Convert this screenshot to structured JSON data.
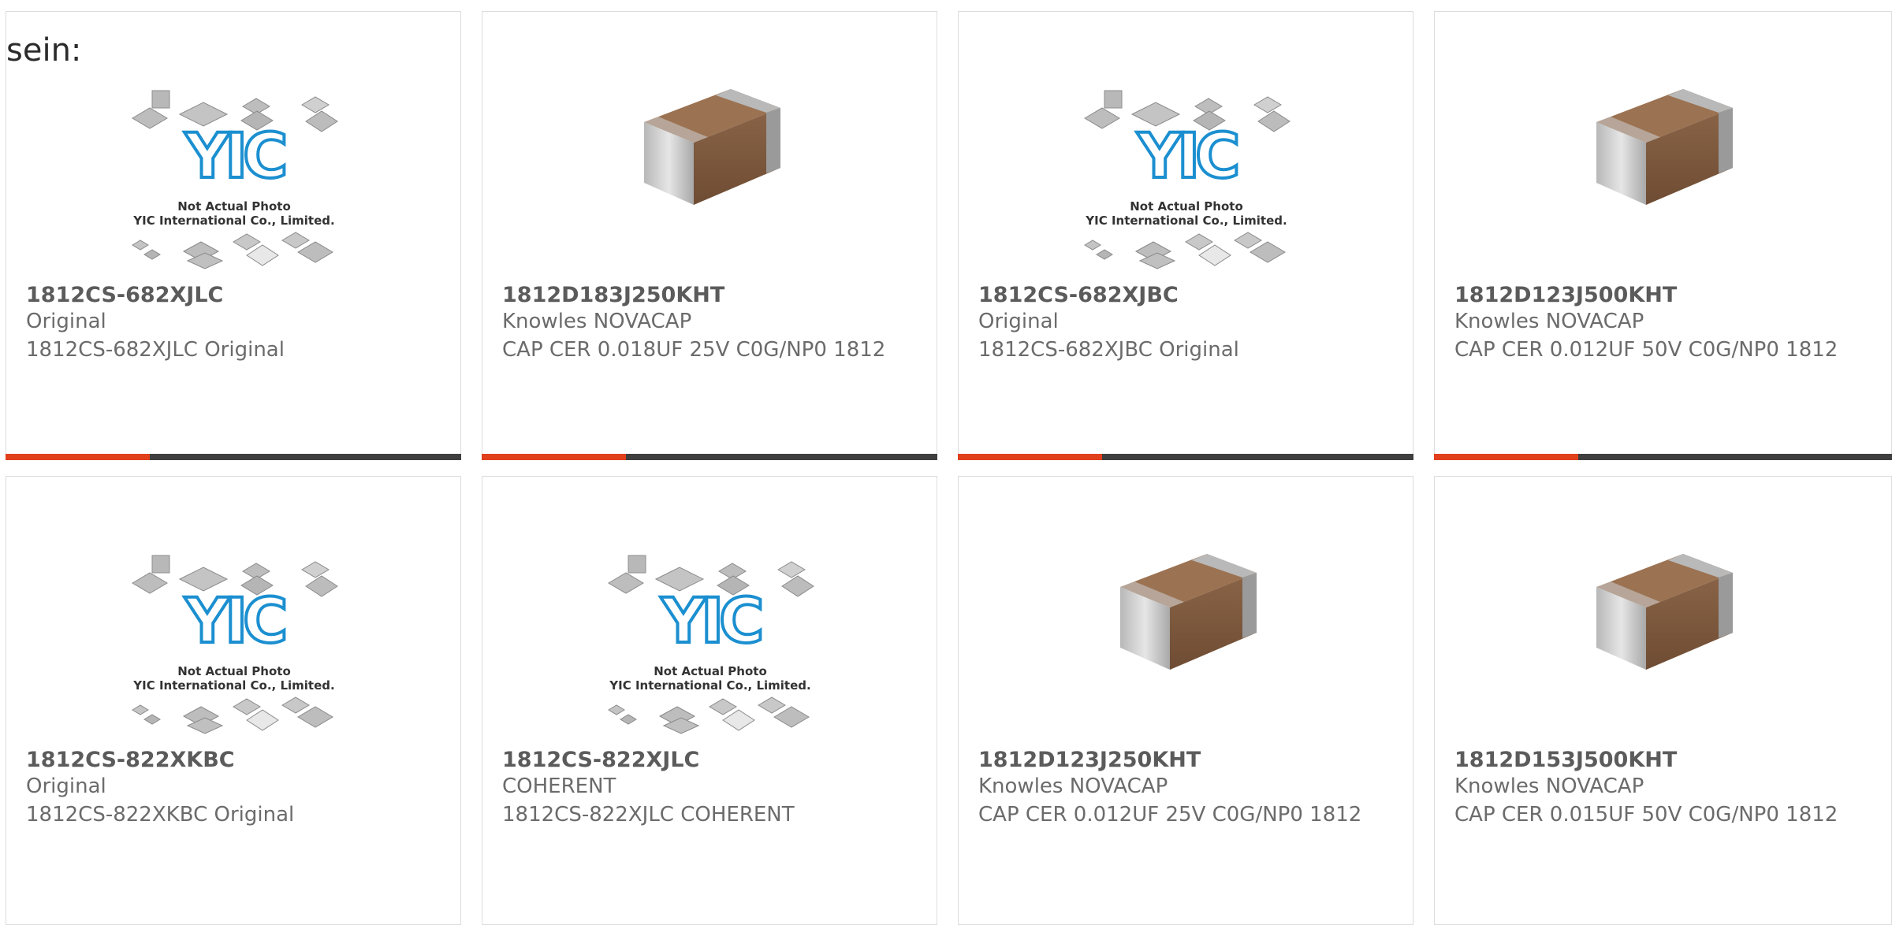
{
  "top_label": "sein:",
  "placeholder_lines": [
    "Not Actual Photo",
    "YIC International Co., Limited."
  ],
  "placeholder_logo_text": "YIC",
  "products": [
    {
      "part": "1812CS-682XJLC",
      "maker": "Original",
      "desc": "1812CS-682XJLC Original",
      "image": "placeholder"
    },
    {
      "part": "1812D183J250KHT",
      "maker": "Knowles NOVACAP",
      "desc": "CAP CER 0.018UF 25V C0G/NP0 1812",
      "image": "capacitor"
    },
    {
      "part": "1812CS-682XJBC",
      "maker": "Original",
      "desc": "1812CS-682XJBC Original",
      "image": "placeholder"
    },
    {
      "part": "1812D123J500KHT",
      "maker": "Knowles NOVACAP",
      "desc": "CAP CER 0.012UF 50V C0G/NP0 1812",
      "image": "capacitor"
    },
    {
      "part": "1812CS-822XKBC",
      "maker": "Original",
      "desc": "1812CS-822XKBC Original",
      "image": "placeholder"
    },
    {
      "part": "1812CS-822XJLC",
      "maker": "COHERENT",
      "desc": "1812CS-822XJLC COHERENT",
      "image": "placeholder"
    },
    {
      "part": "1812D123J250KHT",
      "maker": "Knowles NOVACAP",
      "desc": "CAP CER 0.012UF 25V C0G/NP0 1812",
      "image": "capacitor"
    },
    {
      "part": "1812D153J500KHT",
      "maker": "Knowles NOVACAP",
      "desc": "CAP CER 0.015UF 50V C0G/NP0 1812",
      "image": "capacitor"
    }
  ],
  "colors": {
    "accent": "#e0401c",
    "bar": "#3f3f3f",
    "logo": "#1b8fd0"
  }
}
